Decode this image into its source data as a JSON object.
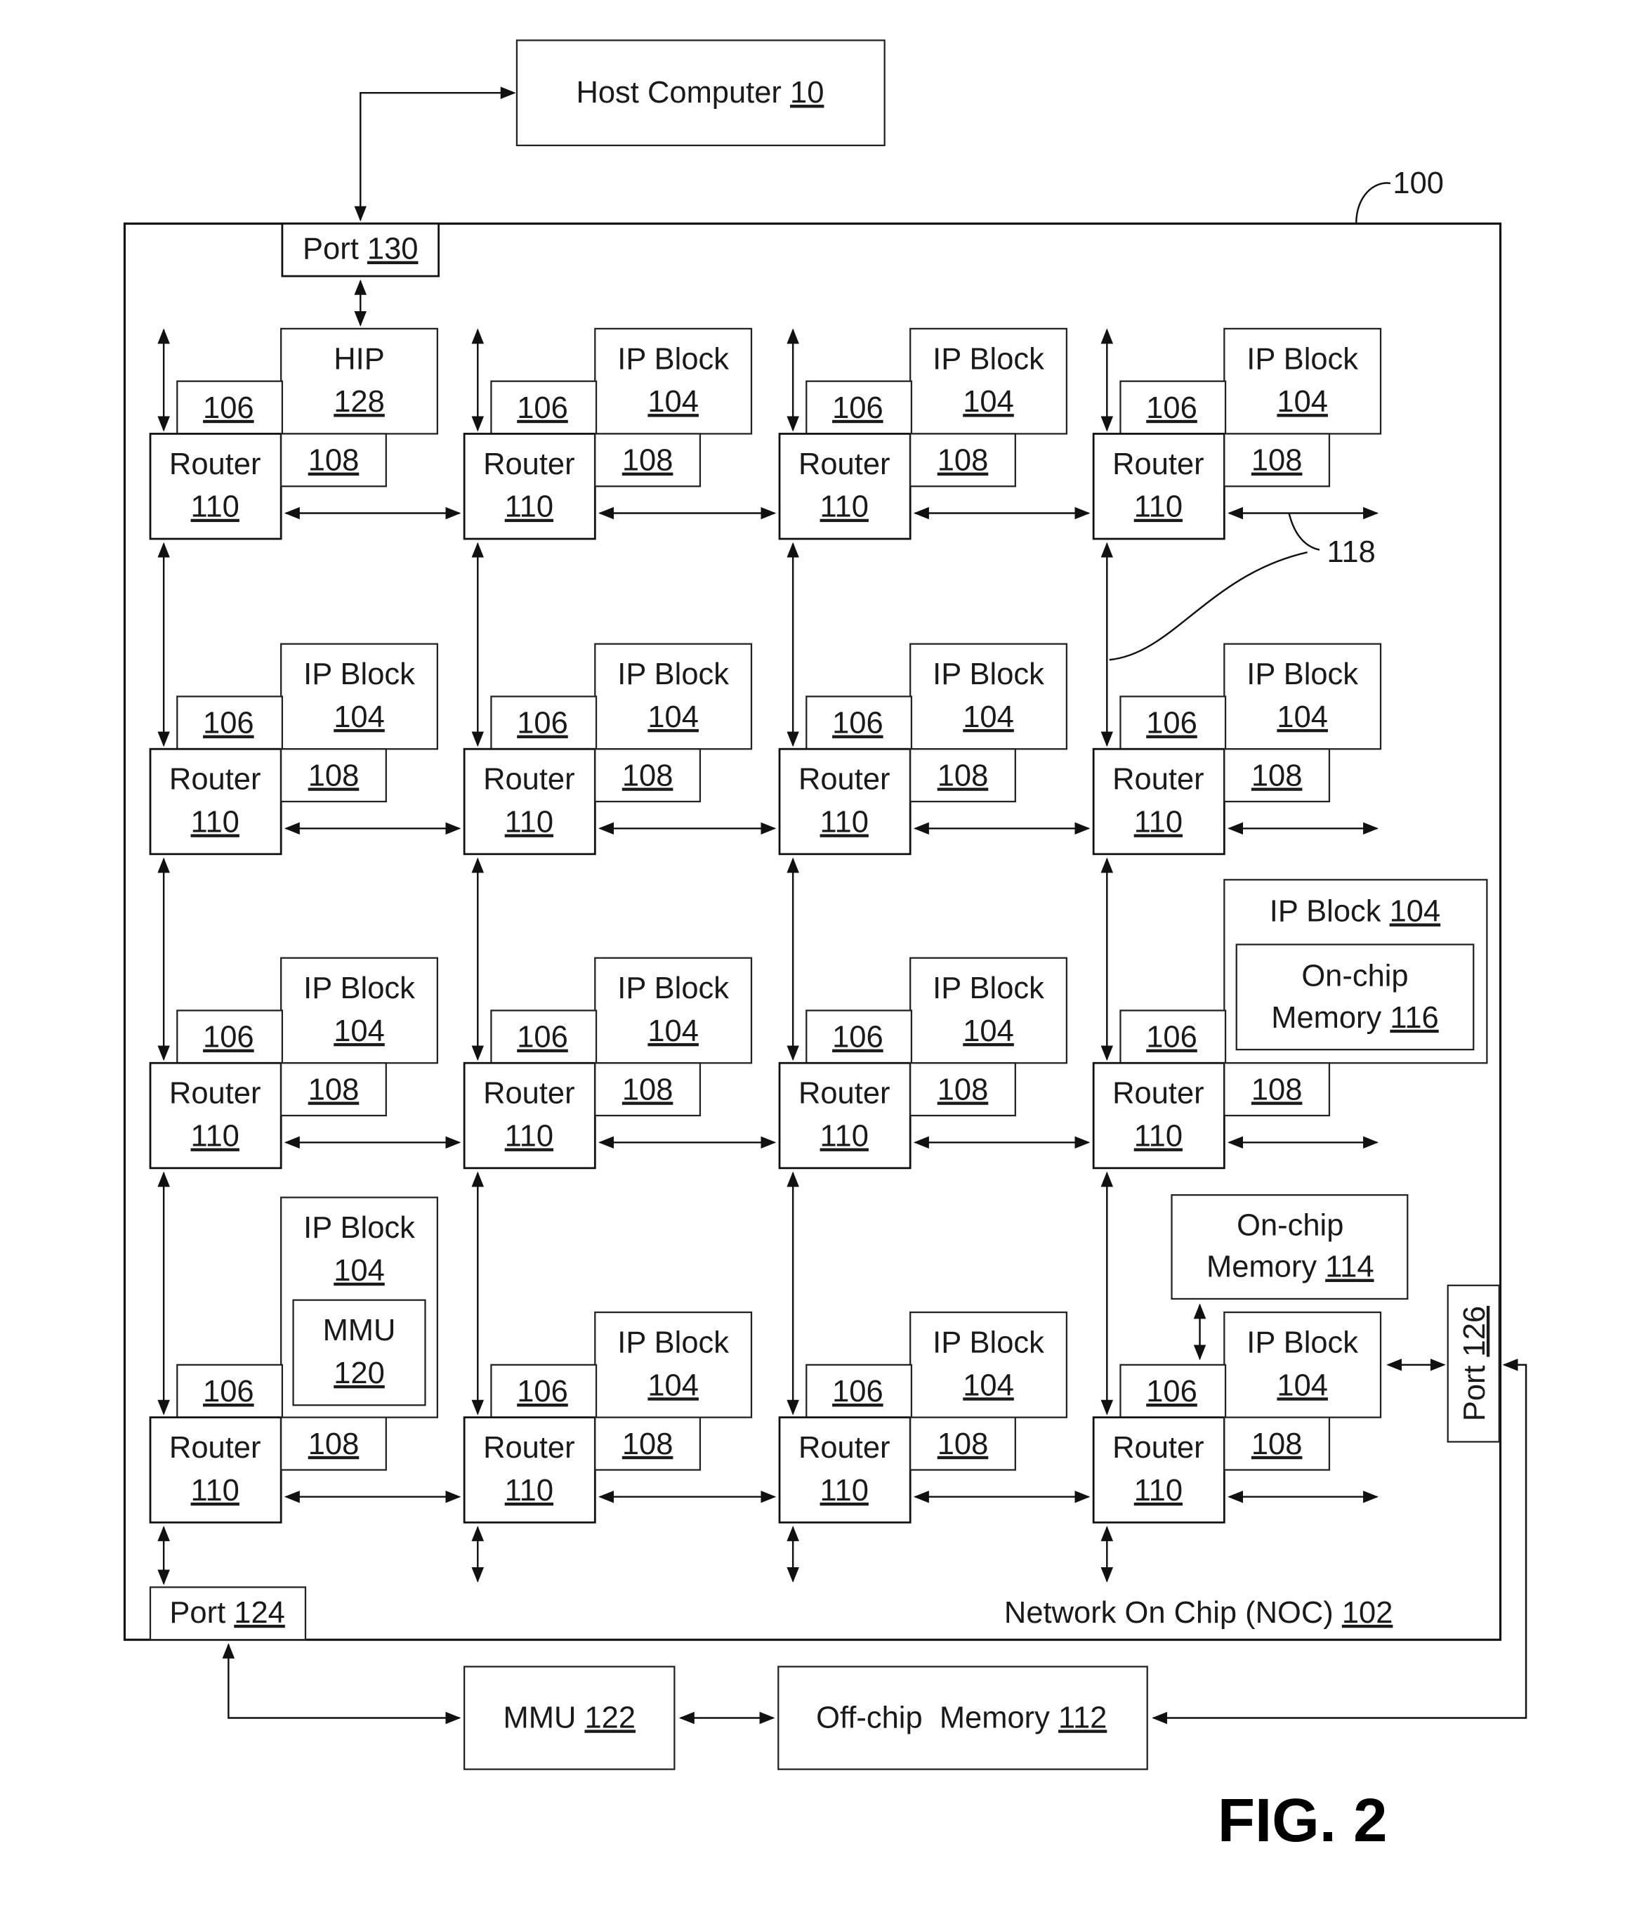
{
  "figure_label": "FIG. 2",
  "ref_100": "100",
  "ref_118": "118",
  "host_computer": {
    "name": "Host Computer",
    "ref": "10"
  },
  "noc": {
    "name": "Network On Chip (NOC)",
    "ref": "102"
  },
  "port_130": {
    "name": "Port",
    "ref": "130"
  },
  "port_124": {
    "name": "Port",
    "ref": "124"
  },
  "port_126": {
    "name": "Port",
    "ref": "126"
  },
  "mmu_122": {
    "name": "MMU",
    "ref": "122"
  },
  "offchip_memory": {
    "name": "Off-chip  Memory",
    "ref": "112"
  },
  "onchip_memory_114": {
    "line1": "On-chip",
    "line2": "Memory",
    "ref": "114"
  },
  "onchip_memory_116": {
    "line1": "On-chip",
    "line2": "Memory",
    "ref": "116"
  },
  "mmu_120": {
    "name": "MMU",
    "ref": "120"
  },
  "hip": {
    "name": "HIP",
    "ref": "128"
  },
  "ip_block": {
    "name": "IP Block",
    "ref": "104"
  },
  "router": {
    "name": "Router",
    "ref": "110"
  },
  "interface_106": "106",
  "interface_108": "108",
  "grid": {
    "rows": 4,
    "cols": 4,
    "nodes": [
      [
        "hip",
        "ip",
        "ip",
        "ip"
      ],
      [
        "ip",
        "ip",
        "ip",
        "ip"
      ],
      [
        "ip",
        "ip",
        "ip",
        "ip-onchip-116"
      ],
      [
        "ip-mmu-120",
        "ip",
        "ip",
        "ip-port-126"
      ]
    ]
  }
}
